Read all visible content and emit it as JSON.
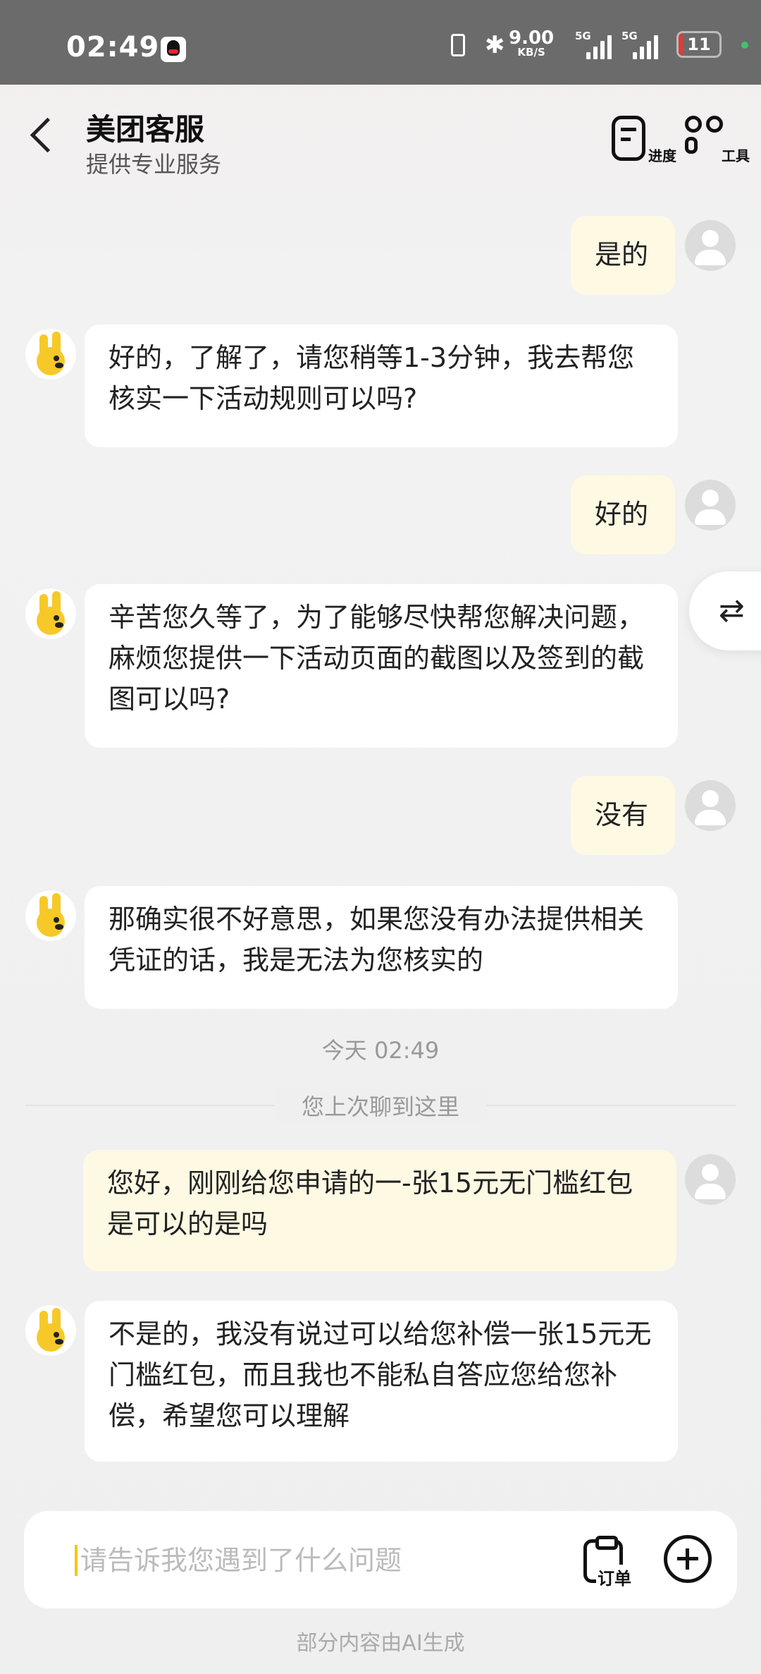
{
  "status_bar": {
    "time": "02:49",
    "net_speed": "9.00",
    "net_unit": "KB/S",
    "sim1_label": "5G",
    "sim2_label": "5G",
    "battery": "11",
    "battery_color": "#e03a3a"
  },
  "header": {
    "title": "美团客服",
    "subtitle": "提供专业服务",
    "progress_label": "进度",
    "tools_label": "工具"
  },
  "messages": [
    {
      "from": "user",
      "text": "是的"
    },
    {
      "from": "bot",
      "text": "好的，了解了，请您稍等1-3分钟，我去帮您核实一下活动规则可以吗?"
    },
    {
      "from": "user",
      "text": "好的"
    },
    {
      "from": "bot",
      "text": "辛苦您久等了，为了能够尽快帮您解决问题，麻烦您提供一下活动页面的截图以及签到的截图可以吗?"
    },
    {
      "from": "user",
      "text": "没有"
    },
    {
      "from": "bot",
      "text": "那确实很不好意思，如果您没有办法提供相关凭证的话，我是无法为您核实的"
    },
    {
      "from": "user",
      "text": "您好，刚刚给您申请的一-张15元无门槛红包是可以的是吗"
    },
    {
      "from": "bot",
      "text": "不是的，我没有说过可以给您补偿一张15元无门槛红包，而且我也不能私自答应您给您补偿，希望您可以理解"
    }
  ],
  "timestamp": "今天 02:49",
  "divider_text": "您上次聊到这里",
  "switch_icon": "⇄",
  "input": {
    "placeholder": "请告诉我您遇到了什么问题",
    "order_label": "订单"
  },
  "footer_note": "部分内容由AI生成",
  "colors": {
    "user_bubble": "#fdf9e3",
    "bot_bubble": "#ffffff",
    "accent": "#f5c518"
  }
}
